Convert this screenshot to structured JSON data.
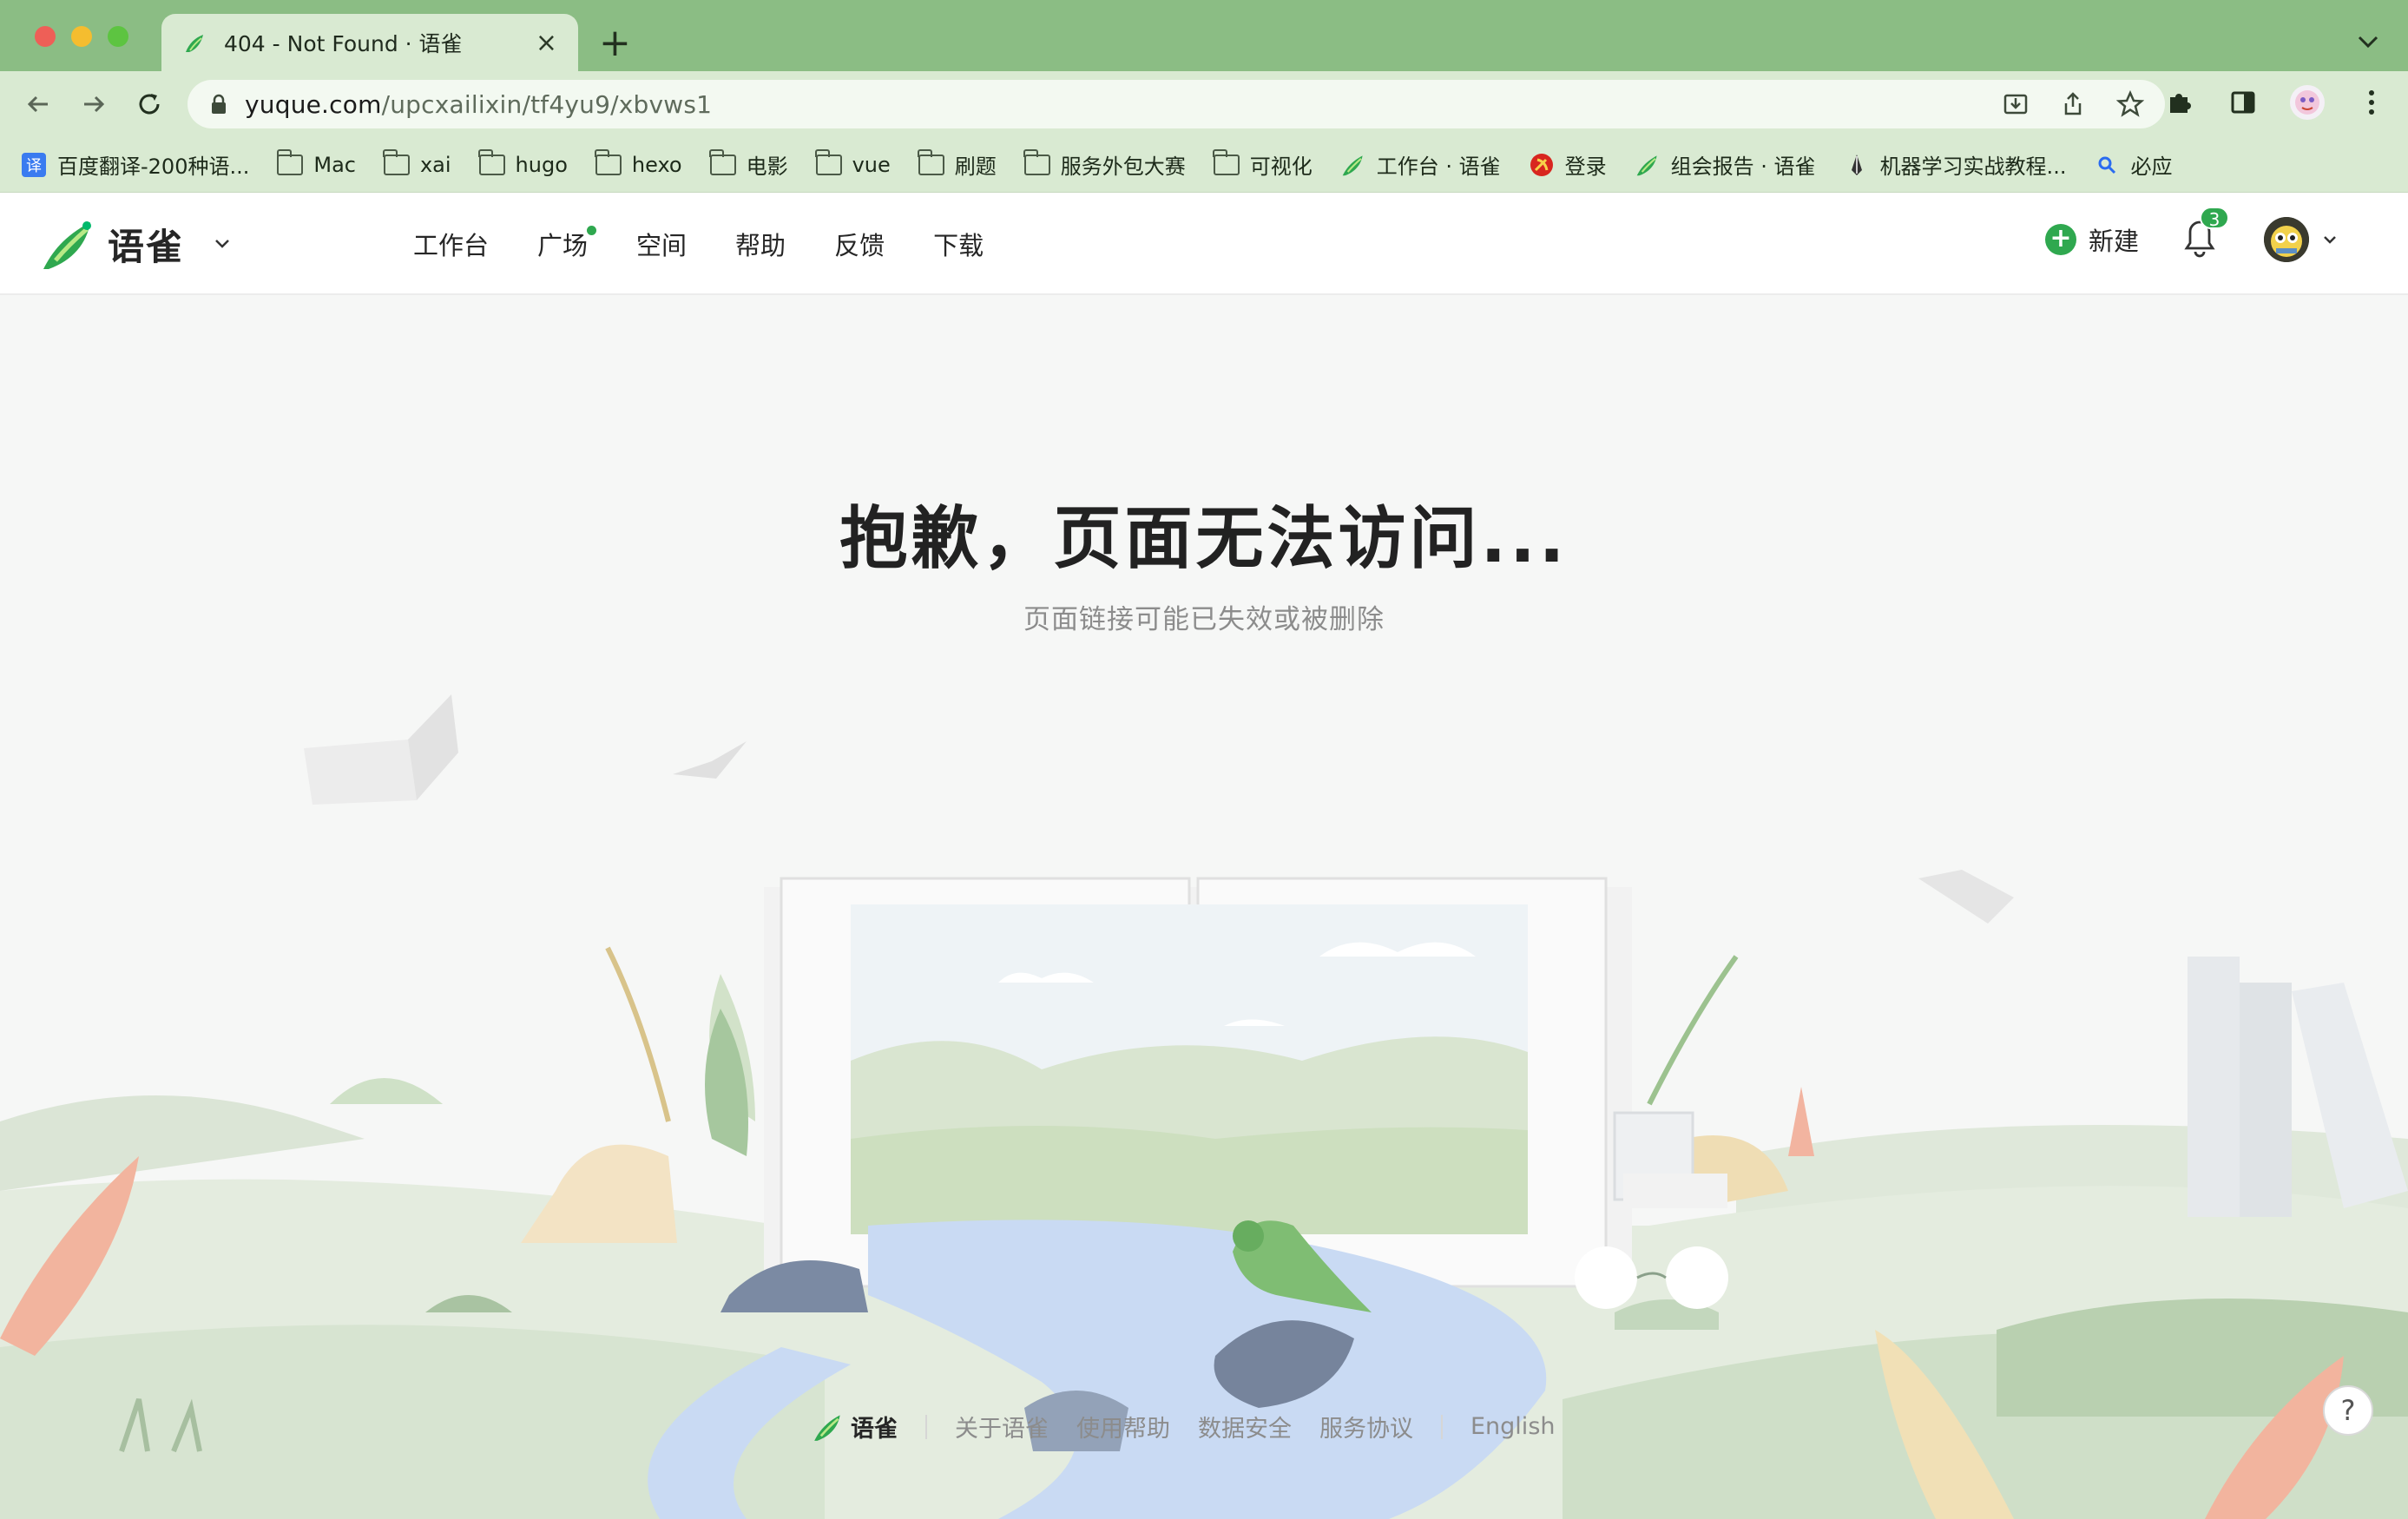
{
  "browser": {
    "tab": {
      "title": "404 - Not Found · 语雀"
    },
    "address": {
      "host": "yuque.com",
      "path": "/upcxailixin/tf4yu9/xbvws1"
    },
    "bookmarks": [
      {
        "label": "百度翻译-200种语...",
        "icon": "translate-icon"
      },
      {
        "label": "Mac",
        "icon": "folder-icon"
      },
      {
        "label": "xai",
        "icon": "folder-icon"
      },
      {
        "label": "hugo",
        "icon": "folder-icon"
      },
      {
        "label": "hexo",
        "icon": "folder-icon"
      },
      {
        "label": "电影",
        "icon": "folder-icon"
      },
      {
        "label": "vue",
        "icon": "folder-icon"
      },
      {
        "label": "刷题",
        "icon": "folder-icon"
      },
      {
        "label": "服务外包大赛",
        "icon": "folder-icon"
      },
      {
        "label": "可视化",
        "icon": "folder-icon"
      },
      {
        "label": "工作台 · 语雀",
        "icon": "yuque-icon"
      },
      {
        "label": "登录",
        "icon": "party-emblem-icon"
      },
      {
        "label": "组会报告 · 语雀",
        "icon": "yuque-icon"
      },
      {
        "label": "机器学习实战教程...",
        "icon": "pen-icon"
      },
      {
        "label": "必应",
        "icon": "search-icon"
      }
    ]
  },
  "app": {
    "brand": "语雀",
    "nav": [
      "工作台",
      "广场",
      "空间",
      "帮助",
      "反馈",
      "下载"
    ],
    "new_label": "新建",
    "notification_count": "3"
  },
  "error": {
    "title": "抱歉，页面无法访问...",
    "subtitle": "页面链接可能已失效或被删除"
  },
  "footer": {
    "brand": "语雀",
    "links": [
      "关于语雀",
      "使用帮助",
      "数据安全",
      "服务协议"
    ],
    "language": "English"
  },
  "help_label": "?",
  "colors": {
    "brand_green": "#2fa84f",
    "chrome_green": "#8bbd84",
    "toolbar_green": "#d9ead2"
  }
}
